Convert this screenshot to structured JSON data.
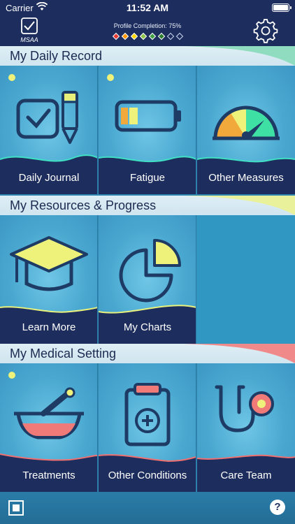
{
  "status_bar": {
    "carrier": "Carrier",
    "time": "11:52 AM"
  },
  "header": {
    "logo_text": "MSAA",
    "profile_completion": "Profile Completion: 75%",
    "profile_completion_value": 75,
    "diamond_colors": [
      "#e53935",
      "#ff9800",
      "#ffd600",
      "#8bc34a",
      "#43a047",
      "#2e7d32",
      "none",
      "none"
    ]
  },
  "sections": {
    "daily_record": {
      "title": "My Daily Record",
      "accent_color": "#8fdcc0",
      "tiles": [
        {
          "label": "Daily Journal",
          "icon": "checklist-pencil-icon",
          "has_dot": true,
          "wave_color": "#3fe0c4"
        },
        {
          "label": "Fatigue",
          "icon": "battery-icon",
          "has_dot": true,
          "wave_color": "#3fe0c4"
        },
        {
          "label": "Other Measures",
          "icon": "gauge-icon",
          "has_dot": false,
          "wave_color": "#3fe0c4"
        }
      ]
    },
    "resources": {
      "title": "My Resources & Progress",
      "accent_color": "#e9f29a",
      "tiles": [
        {
          "label": "Learn More",
          "icon": "graduation-cap-icon",
          "has_dot": false,
          "wave_color": "#e9f27a"
        },
        {
          "label": "My Charts",
          "icon": "pie-chart-icon",
          "has_dot": false,
          "wave_color": "#e9f27a"
        }
      ]
    },
    "medical": {
      "title": "My Medical Setting",
      "accent_color": "#f08a8a",
      "tiles": [
        {
          "label": "Treatments",
          "icon": "mortar-pestle-icon",
          "has_dot": true,
          "wave_color": "#f0706f"
        },
        {
          "label": "Other Conditions",
          "icon": "clipboard-medical-icon",
          "has_dot": false,
          "wave_color": "#f0706f"
        },
        {
          "label": "Care Team",
          "icon": "stethoscope-icon",
          "has_dot": false,
          "wave_color": "#f0706f"
        }
      ]
    }
  },
  "bottom_bar": {
    "help_label": "?"
  }
}
